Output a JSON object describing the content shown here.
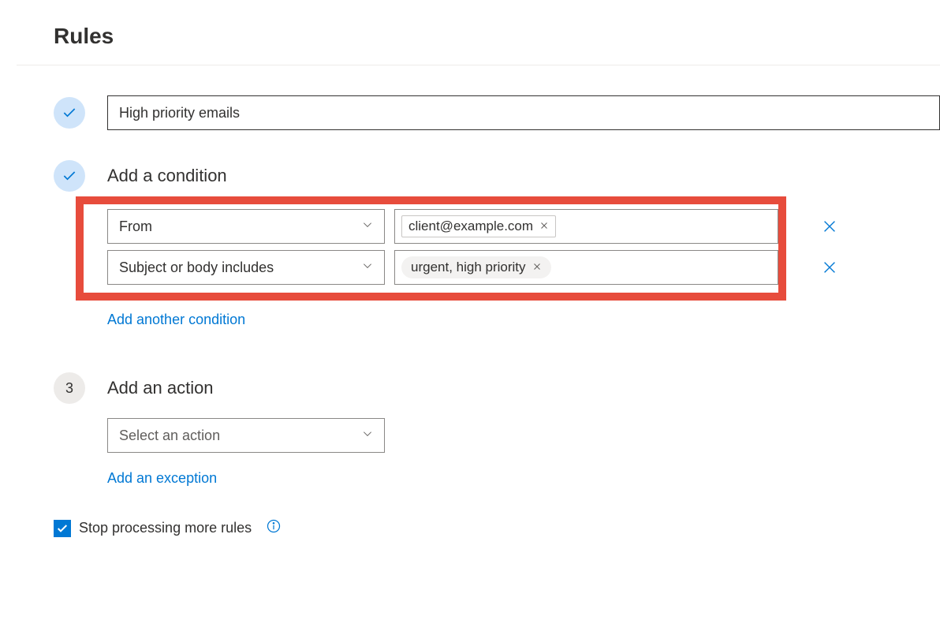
{
  "page": {
    "title": "Rules"
  },
  "rule": {
    "name": "High priority emails"
  },
  "conditions": {
    "title": "Add a condition",
    "rows": [
      {
        "field": "From",
        "value": "client@example.com"
      },
      {
        "field": "Subject or body includes",
        "value": "urgent, high priority"
      }
    ],
    "add_link": "Add another condition"
  },
  "actions": {
    "title": "Add an action",
    "placeholder": "Select an action",
    "add_exception_link": "Add an exception"
  },
  "step3": "3",
  "stop": {
    "label": "Stop processing more rules",
    "checked": true
  }
}
